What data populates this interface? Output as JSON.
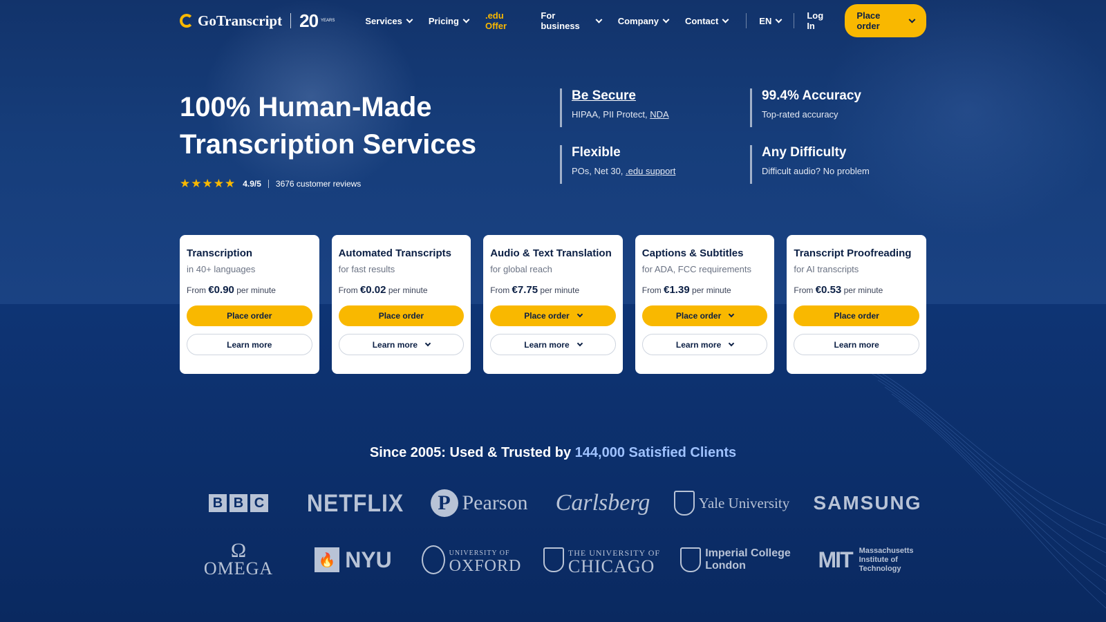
{
  "brand": {
    "name": "GoTranscript",
    "anniversary": "20",
    "anniversary_sub": "YEARS",
    "accent_color": "#f9b800",
    "bg_color": "#0b2d66"
  },
  "nav": {
    "items": [
      {
        "label": "Services",
        "dropdown": true
      },
      {
        "label": "Pricing",
        "dropdown": true
      },
      {
        "label": ".edu Offer",
        "dropdown": false
      },
      {
        "label": "For business",
        "dropdown": true
      },
      {
        "label": "Company",
        "dropdown": true
      },
      {
        "label": "Contact",
        "dropdown": true
      }
    ],
    "language": "EN",
    "login": "Log In",
    "order": "Place order"
  },
  "hero": {
    "title": "100% Human-Made Transcription Services",
    "rating_score": "4.9/5",
    "reviews": "3676 customer reviews",
    "stars": "★★★★★"
  },
  "features": [
    {
      "title": "Be Secure",
      "desc_prefix": "HIPAA, PII Protect, ",
      "desc_link": "NDA"
    },
    {
      "title": "99.4% Accuracy",
      "desc_prefix": "Top-rated accuracy",
      "desc_link": ""
    },
    {
      "title": "Flexible",
      "desc_prefix": "POs, Net 30, ",
      "desc_link": ".edu support"
    },
    {
      "title": "Any Difficulty",
      "desc_prefix": "Difficult audio? No problem",
      "desc_link": ""
    }
  ],
  "cards": [
    {
      "title": "Transcription",
      "sub": "in 40+ languages",
      "from": "From",
      "price": "€0.90",
      "unit": "per minute",
      "order": "Place order",
      "learn": "Learn more"
    },
    {
      "title": "Automated Transcripts",
      "sub": "for fast results",
      "from": "From",
      "price": "€0.02",
      "unit": "per minute",
      "order": "Place order",
      "learn": "Learn more"
    },
    {
      "title": "Audio & Text Translation",
      "sub": "for global reach",
      "from": "From",
      "price": "€7.75",
      "unit": "per minute",
      "order": "Place order",
      "learn": "Learn more"
    },
    {
      "title": "Captions & Subtitles",
      "sub": "for ADA, FCC requirements",
      "from": "From",
      "price": "€1.39",
      "unit": "per minute",
      "order": "Place order",
      "learn": "Learn more"
    },
    {
      "title": "Transcript Proofreading",
      "sub": "for AI transcripts",
      "from": "From",
      "price": "€0.53",
      "unit": "per minute",
      "order": "Place order",
      "learn": "Learn more"
    }
  ],
  "trusted": {
    "prefix": "Since 2005: Used & Trusted by ",
    "highlight": "144,000 Satisfied Clients"
  },
  "clients": {
    "bbc": [
      "B",
      "B",
      "C"
    ],
    "netflix": "NETFLIX",
    "pearson": "Pearson",
    "carlsberg": "Carlsberg",
    "yale": "Yale University",
    "samsung": "SAMSUNG",
    "omega_symbol": "Ω",
    "omega": "OMEGA",
    "nyu": "NYU",
    "oxford_small": "UNIVERSITY OF",
    "oxford": "OXFORD",
    "chicago_small": "THE UNIVERSITY OF",
    "chicago": "CHICAGO",
    "imperial_1": "Imperial College",
    "imperial_2": "London",
    "mit_bars": "MIT",
    "mit_1": "Massachusetts",
    "mit_2": "Institute of",
    "mit_3": "Technology"
  }
}
